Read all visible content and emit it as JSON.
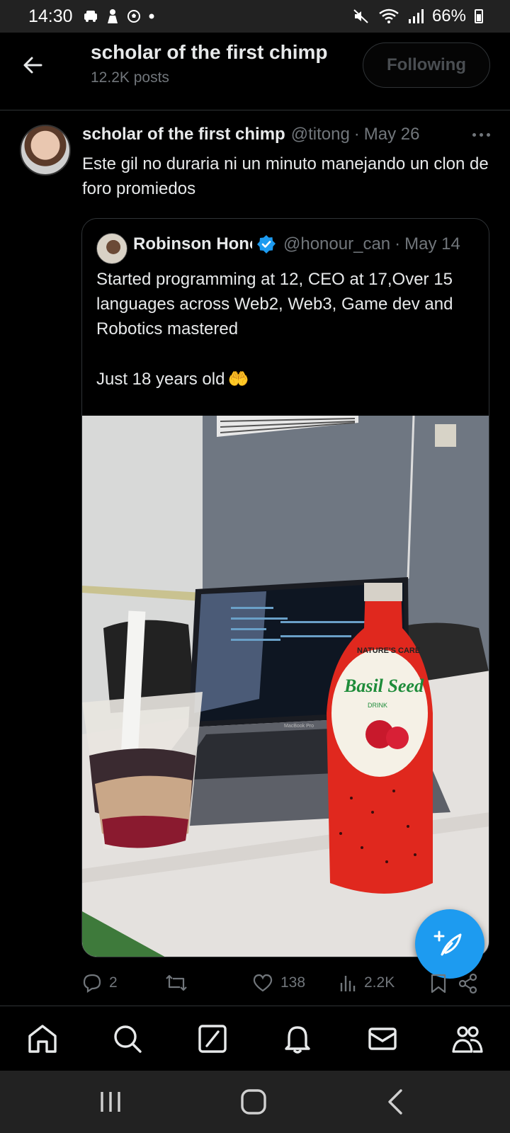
{
  "status_bar": {
    "time": "14:30",
    "battery": "66%",
    "left_icons": [
      "car-icon",
      "person-icon",
      "soccer-icon",
      "dot-icon"
    ],
    "right_icons": [
      "mute-icon",
      "wifi-icon",
      "signal-icon",
      "battery-icon"
    ]
  },
  "header": {
    "title": "scholar of the first chimp",
    "subtitle": "12.2K posts",
    "follow_label": "Following"
  },
  "tweet": {
    "name": "scholar of the first chimp",
    "handle": "@titong",
    "dot": "·",
    "date": "May 26",
    "text": "Este gil no duraria ni un minuto manejando un clon de foro promiedos"
  },
  "quote": {
    "name": "Robinson Honour",
    "handle": "@honour_can",
    "dot": "·",
    "date": "May 14",
    "text": "Started programming at 12, CEO at 17,Over 15 languages across Web2, Web3, Game dev and Robotics mastered",
    "text_last": "Just 18 years old",
    "emoji": "🤲",
    "photo": {
      "laptop_label": "MacBook Pro",
      "bottle_brand": "NATURE'S CARE",
      "bottle_product": "Basil Seed",
      "bottle_drink": "DRINK"
    }
  },
  "actions": {
    "replies": "2",
    "likes": "138",
    "views": "2.2K"
  },
  "nav": [
    "home-icon",
    "search-icon",
    "grok-icon",
    "notifications-icon",
    "messages-icon",
    "communities-icon"
  ],
  "colors": {
    "accent": "#1d9bf0",
    "text": "#e7e9ea",
    "muted": "#71767b",
    "border": "#2f3336"
  }
}
